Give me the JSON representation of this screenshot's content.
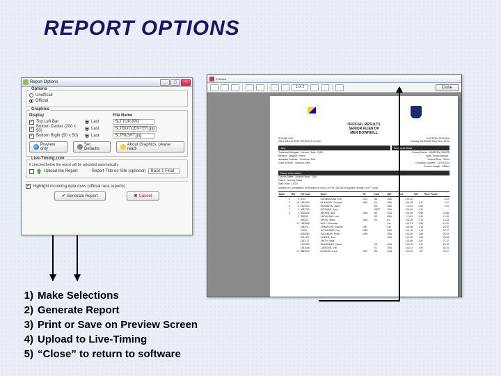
{
  "slide": {
    "title": "REPORT OPTIONS"
  },
  "steps": [
    {
      "n": "1)",
      "t": "Make Selections"
    },
    {
      "n": "2)",
      "t": "Generate Report"
    },
    {
      "n": "3)",
      "t": "Print or Save on Preview Screen"
    },
    {
      "n": "4)",
      "t": "Upload to Live-Timing"
    },
    {
      "n": "5)",
      "t": "“Close” to return to software"
    }
  ],
  "dialog": {
    "title": "Report Options",
    "options_label": "Options",
    "opt_unofficial": "Unofficial",
    "opt_official": "Official",
    "graphics_label": "Graphics",
    "col_display": "Display",
    "col_filename": "File Name",
    "row1_label": "Top Left Bar",
    "row1_last": "Last",
    "row1_file": "SLTTOP.JPG",
    "row2_label": "Bottom Center (200 x 50)",
    "row2_last": "Last",
    "row2_file": "SLTBOTCENTER.jpg",
    "row3_label": "Bottom Right (50 x 50)",
    "row3_last": "Last",
    "row3_file": "SLTRIGHT.jpg",
    "btn_preview": "Preview only",
    "btn_default": "Set Defaults",
    "btn_about": "About Graphics, please read!",
    "live_label": "Live-Timing.com",
    "live_desc": "If checked below the report will be uploaded automatically",
    "live_upload": "Upload the Report",
    "live_title_lbl": "Report Title on Site (optional)",
    "live_title_val": "Race 1 Final",
    "highlight": "Highlight incoming data rows (official race reports)",
    "btn_generate": "Generate Report",
    "btn_cancel": "Cancel"
  },
  "preview": {
    "title": "Preview",
    "zoom": "1 of 2",
    "close": "Close",
    "doc": {
      "h1": "OFFICIAL RESULTS",
      "h2": "SENIOR ALIEN DP",
      "h3": "MEN DOWNHILL",
      "jury_label": "Jury",
      "tech_label": "Technical Data",
      "race_label": "Race Information",
      "venue": "SUGARLOAF",
      "season": "2014-2015 ALPINE OFFICIALS CLINIC",
      "date_line": "Tuesday 3/18/2015 Start Time 13:00",
      "region": "EASTERN DIVISION",
      "jury": [
        [
          "Technical Delegate",
          "Lanceri, John",
          "CAN"
        ],
        [
          "Referee",
          "Wagner, Pierre",
          ""
        ],
        [
          "Assistant Referee",
          "Guilherm, Dita",
          ""
        ],
        [
          "Chief of Race",
          "Samson, Mee",
          ""
        ]
      ],
      "tech": [
        [
          "Course Name",
          "NARROW GAUGE"
        ],
        [
          "Start / Finish Altitude",
          ""
        ],
        [
          "Vertical Drop",
          "510m"
        ],
        [
          "Homolog. Number",
          "11767/3/14"
        ],
        [
          "Course Length",
          "2350m"
        ]
      ],
      "race": [
        [
          "Course Setter",
          "Aurelio Parse",
          "USA"
        ],
        [
          "Gates / Turning Gates",
          "",
          ""
        ],
        [
          "Start Time",
          "13:00",
          ""
        ]
      ],
      "counts": "Number of Competitors: 55  Number of NOCs: 6  FIS List #1519   Applied Penalty  0.00        F=1250",
      "columns": [
        "Rank",
        "Bib",
        "FIS Code",
        "Name",
        "YB",
        "Club",
        "NAT",
        "Time",
        "Diff.",
        "Race Points"
      ],
      "rows": [
        [
          "4",
          "6",
          "6370",
          "CUNNINGHAM, Ron",
          "1972",
          "SB",
          "USA",
          "1:01.12",
          "",
          "3.03"
        ],
        [
          "9",
          "16",
          "6394263",
          "MCKINNEY, Thomas",
          "1964",
          "KA",
          "USA",
          "1:01.65",
          "0.11",
          "2.47"
        ],
        [
          "6",
          "5",
          "5419423",
          "ROBINSON, Jared",
          "",
          "SG",
          "USA",
          "1:01.9",
          "0.51",
          "1.51"
        ],
        [
          "7",
          "7",
          "6081223",
          "WOOMER, Syne",
          "",
          "SBST",
          "USA",
          "1:01.84",
          "0.31",
          ""
        ],
        [
          "8",
          "3",
          "6815029",
          "BROWN, Sam",
          "1996",
          "BR",
          "USA",
          "1:01.89",
          "0.66",
          "10.88"
        ],
        [
          "",
          "9",
          "539826",
          "KNOWLAND, Lee",
          "",
          "SR",
          "USA",
          "1:01.9",
          "0.52",
          "11.49"
        ],
        [
          "",
          "",
          "399324",
          "WHITE, Willey",
          "1969",
          "SR",
          "RC",
          "1:01.25",
          "0.72",
          "13.33"
        ],
        [
          "",
          "11",
          "1563065",
          "WOLL, Wookster",
          "",
          "",
          "Cze",
          "1:01.43",
          "0.83",
          "14.92"
        ],
        [
          "",
          "",
          "186276",
          "CRAWFORD, Antonie",
          "1987",
          "",
          "Cze",
          "1:01.66",
          "1.15",
          "23.92"
        ],
        [
          "",
          "",
          "41796",
          "ALEXANDER, Roy",
          "1999",
          "",
          "USA",
          "1:01.79",
          "1.15",
          "23.77"
        ],
        [
          "",
          "",
          "6028283",
          "RADAMURI, Rime",
          "1969",
          "",
          "USA",
          "1:01.80",
          "1.58",
          "26.43"
        ],
        [
          "",
          "",
          "3221417",
          "COWES, Josh",
          "",
          "",
          "USA",
          "1:01.80",
          "1.56",
          "28.63"
        ],
        [
          "",
          "",
          "1351172",
          "SMITH, Ralia",
          "",
          "",
          "",
          "1:01.88",
          "1.67",
          "27.37"
        ],
        [
          "",
          "",
          "1415153",
          "DHARMANN, Cammi",
          "",
          "US",
          "USA",
          "1:02.18",
          "1.91",
          "29.78"
        ],
        [
          "",
          "",
          "1531646",
          "CARBONE, Zeb",
          "",
          "EC",
          "USA",
          "1:02.14",
          "1.93",
          "30.15"
        ],
        [
          "",
          "13",
          "5883219",
          "MONROE, Zack",
          "1997",
          "SR",
          "CAN",
          "1:02.29",
          "1.97",
          "33.47"
        ]
      ]
    }
  },
  "chart_data": {
    "type": "table",
    "title": "OFFICIAL RESULTS — MEN DOWNHILL",
    "columns": [
      "Rank",
      "Bib",
      "FIS Code",
      "Name",
      "YB",
      "Club",
      "NAT",
      "Time",
      "Diff.",
      "Race Points"
    ],
    "rows": [
      [
        "4",
        "6",
        "6370",
        "CUNNINGHAM, Ron",
        "1972",
        "SB",
        "USA",
        "1:01.12",
        "",
        "3.03"
      ],
      [
        "9",
        "16",
        "6394263",
        "MCKINNEY, Thomas",
        "1964",
        "KA",
        "USA",
        "1:01.65",
        "0.11",
        "2.47"
      ],
      [
        "6",
        "5",
        "5419423",
        "ROBINSON, Jared",
        "",
        "SG",
        "USA",
        "1:01.9",
        "0.51",
        "1.51"
      ],
      [
        "7",
        "7",
        "6081223",
        "WOOMER, Syne",
        "",
        "SBST",
        "USA",
        "1:01.84",
        "0.31",
        ""
      ],
      [
        "8",
        "3",
        "6815029",
        "BROWN, Sam",
        "1996",
        "BR",
        "USA",
        "1:01.89",
        "0.66",
        "10.88"
      ],
      [
        "",
        "9",
        "539826",
        "KNOWLAND, Lee",
        "",
        "SR",
        "USA",
        "1:01.9",
        "0.52",
        "11.49"
      ],
      [
        "",
        "",
        "399324",
        "WHITE, Willey",
        "1969",
        "SR",
        "RC",
        "1:01.25",
        "0.72",
        "13.33"
      ],
      [
        "",
        "11",
        "1563065",
        "WOLL, Wookster",
        "",
        "",
        "Cze",
        "1:01.43",
        "0.83",
        "14.92"
      ],
      [
        "",
        "",
        "186276",
        "CRAWFORD, Antonie",
        "1987",
        "",
        "Cze",
        "1:01.66",
        "1.15",
        "23.92"
      ],
      [
        "",
        "",
        "41796",
        "ALEXANDER, Roy",
        "1999",
        "",
        "USA",
        "1:01.79",
        "1.15",
        "23.77"
      ],
      [
        "",
        "",
        "6028283",
        "RADAMURI, Rime",
        "1969",
        "",
        "USA",
        "1:01.80",
        "1.58",
        "26.43"
      ],
      [
        "",
        "",
        "3221417",
        "COWES, Josh",
        "",
        "",
        "USA",
        "1:01.80",
        "1.56",
        "28.63"
      ],
      [
        "",
        "",
        "1351172",
        "SMITH, Ralia",
        "",
        "",
        "",
        "1:01.88",
        "1.67",
        "27.37"
      ],
      [
        "",
        "",
        "1415153",
        "DHARMANN, Cammi",
        "",
        "US",
        "USA",
        "1:02.18",
        "1.91",
        "29.78"
      ],
      [
        "",
        "",
        "1531646",
        "CARBONE, Zeb",
        "",
        "EC",
        "USA",
        "1:02.14",
        "1.93",
        "30.15"
      ],
      [
        "",
        "13",
        "5883219",
        "MONROE, Zack",
        "1997",
        "SR",
        "CAN",
        "1:02.29",
        "1.97",
        "33.47"
      ]
    ]
  }
}
